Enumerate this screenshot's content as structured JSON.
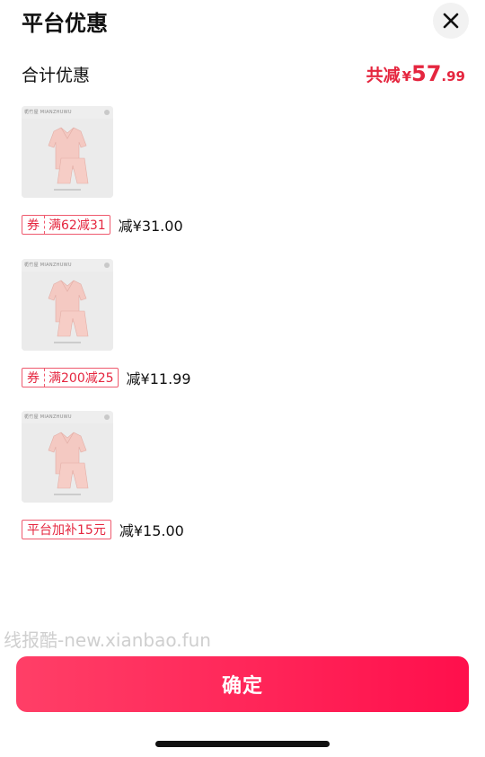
{
  "header": {
    "title": "平台优惠",
    "close_icon": "close-icon"
  },
  "summary": {
    "label": "合计优惠",
    "total_prefix": "共减",
    "total_currency": "¥",
    "total_integer": "57",
    "total_decimal": ".99"
  },
  "items": [
    {
      "brand": "栀竹屋  MIANZHUWU",
      "tag_kind": "券",
      "tag_value": "满62减31",
      "discount": "减¥31.00"
    },
    {
      "brand": "栀竹屋  MIANZHUWU",
      "tag_kind": "券",
      "tag_value": "满200减25",
      "discount": "减¥11.99"
    },
    {
      "brand": "栀竹屋  MIANZHUWU",
      "tag_kind": "",
      "tag_value": "平台加补15元",
      "discount": "减¥15.00"
    }
  ],
  "watermark": "线报酷-new.xianbao.fun",
  "confirm_button": "确定",
  "colors": {
    "accent": "#e5263f",
    "button_start": "#ff3f67",
    "button_end": "#ff0f4c",
    "product": "#f4c9c2"
  }
}
